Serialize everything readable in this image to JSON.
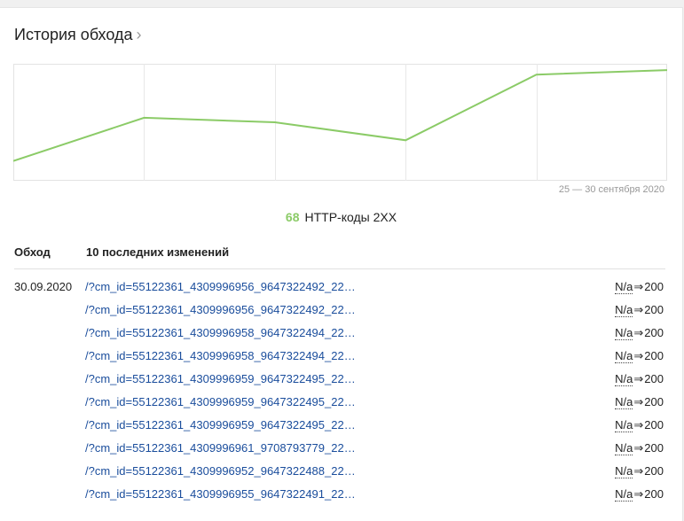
{
  "header": {
    "title": "История обхода",
    "chevron": "›"
  },
  "chart_data": {
    "type": "line",
    "values": [
      22,
      70,
      65,
      45,
      118
    ],
    "ylim": [
      0,
      130
    ],
    "grid": true,
    "caption": "25 — 30 сентября 2020",
    "line_color": "#8bcb67"
  },
  "summary": {
    "count": "68",
    "label": "HTTP-коды 2XX",
    "count_color": "#8bcb67"
  },
  "table": {
    "col_crawl": "Обход",
    "col_changes": "10 последних изменений",
    "rows": [
      {
        "date": "30.09.2020",
        "url": "/?cm_id=55122361_4309996956_9647322492_22…",
        "from": "N/a",
        "arrow": "⇒",
        "to": "200"
      },
      {
        "date": "",
        "url": "/?cm_id=55122361_4309996956_9647322492_22…",
        "from": "N/a",
        "arrow": "⇒",
        "to": "200"
      },
      {
        "date": "",
        "url": "/?cm_id=55122361_4309996958_9647322494_22…",
        "from": "N/a",
        "arrow": "⇒",
        "to": "200"
      },
      {
        "date": "",
        "url": "/?cm_id=55122361_4309996958_9647322494_22…",
        "from": "N/a",
        "arrow": "⇒",
        "to": "200"
      },
      {
        "date": "",
        "url": "/?cm_id=55122361_4309996959_9647322495_22…",
        "from": "N/a",
        "arrow": "⇒",
        "to": "200"
      },
      {
        "date": "",
        "url": "/?cm_id=55122361_4309996959_9647322495_22…",
        "from": "N/a",
        "arrow": "⇒",
        "to": "200"
      },
      {
        "date": "",
        "url": "/?cm_id=55122361_4309996959_9647322495_22…",
        "from": "N/a",
        "arrow": "⇒",
        "to": "200"
      },
      {
        "date": "",
        "url": "/?cm_id=55122361_4309996961_9708793779_22…",
        "from": "N/a",
        "arrow": "⇒",
        "to": "200"
      },
      {
        "date": "",
        "url": "/?cm_id=55122361_4309996952_9647322488_22…",
        "from": "N/a",
        "arrow": "⇒",
        "to": "200"
      },
      {
        "date": "",
        "url": "/?cm_id=55122361_4309996955_9647322491_22…",
        "from": "N/a",
        "arrow": "⇒",
        "to": "200"
      }
    ]
  }
}
